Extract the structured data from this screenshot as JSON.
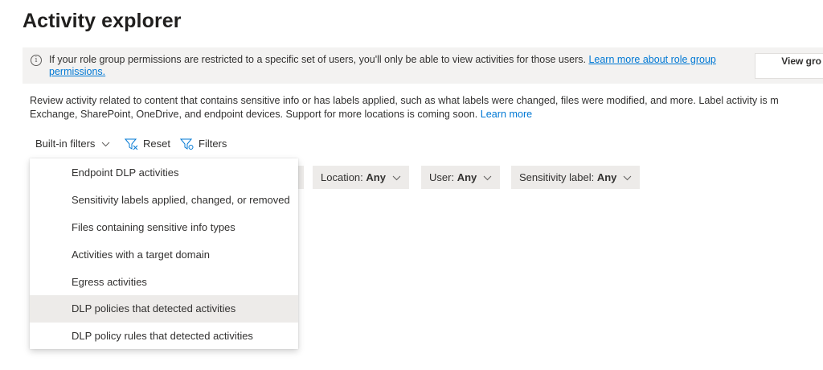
{
  "page": {
    "title": "Activity explorer"
  },
  "banner": {
    "icon": "info-icon",
    "text": "If your role group permissions are restricted to a specific set of users, you'll only be able to view activities for those users. ",
    "link": "Learn more about role group permissions.",
    "button_label": "View gro"
  },
  "description": {
    "line1": "Review activity related to content that contains sensitive info or has labels applied, such as what labels were changed, files were modified, and more. Label activity is m",
    "line2": "Exchange, SharePoint, OneDrive, and endpoint devices. Support for more locations is coming soon. ",
    "link": "Learn more"
  },
  "toolbar": {
    "builtin_label": "Built-in filters",
    "reset_label": "Reset",
    "filters_label": "Filters"
  },
  "filters": [
    {
      "label": "Location:",
      "value": "Any"
    },
    {
      "label": "User:",
      "value": "Any"
    },
    {
      "label": "Sensitivity label:",
      "value": "Any"
    }
  ],
  "builtin_menu": {
    "items": [
      "Endpoint DLP activities",
      "Sensitivity labels applied, changed, or removed",
      "Files containing sensitive info types",
      "Activities with a target domain",
      "Egress activities",
      "DLP policies that detected activities",
      "DLP policy rules that detected activities"
    ],
    "highlighted_index": 5
  },
  "colors": {
    "accent": "#0078d4",
    "banner_bg": "#f3f2f1",
    "pill_bg": "#edebe9"
  }
}
